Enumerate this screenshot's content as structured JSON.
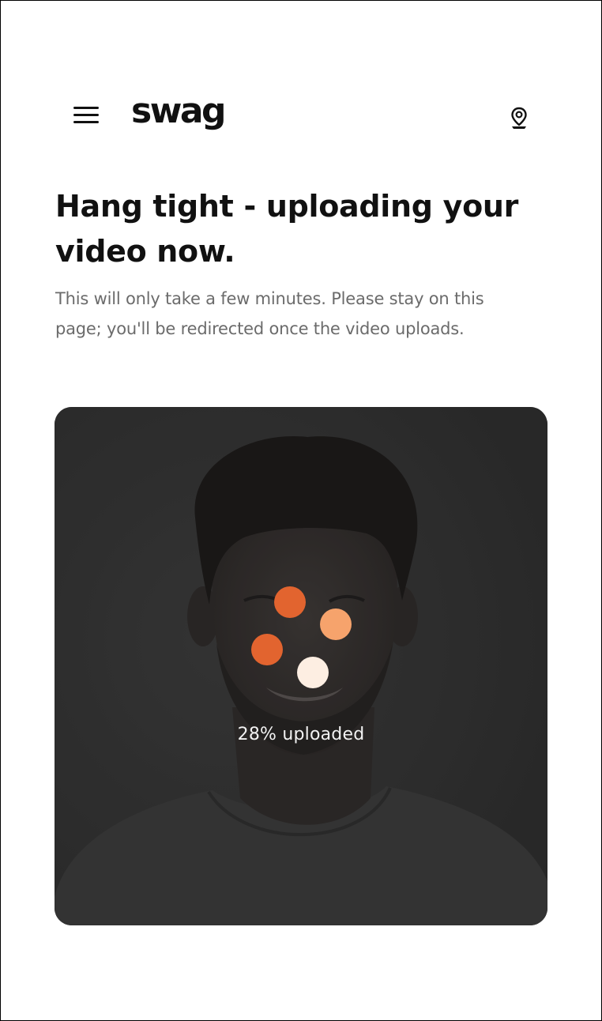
{
  "header": {
    "logo_text": "swag",
    "menu_icon": "hamburger-menu-icon",
    "account_icon": "user-pin-icon"
  },
  "main": {
    "headline": "Hang tight - uploading your video now.",
    "subtext": "This will only take a few minutes. Please stay on this page; you'll be redirected once the video uploads."
  },
  "upload": {
    "progress_percent": 28,
    "progress_label": "28% uploaded",
    "spinner_colors": [
      "#e2642f",
      "#f6a36c",
      "#e2642f",
      "#fdeee2"
    ]
  },
  "colors": {
    "text_primary": "#111111",
    "text_secondary": "#6b6b6b",
    "card_background": "#2e2e2e"
  }
}
